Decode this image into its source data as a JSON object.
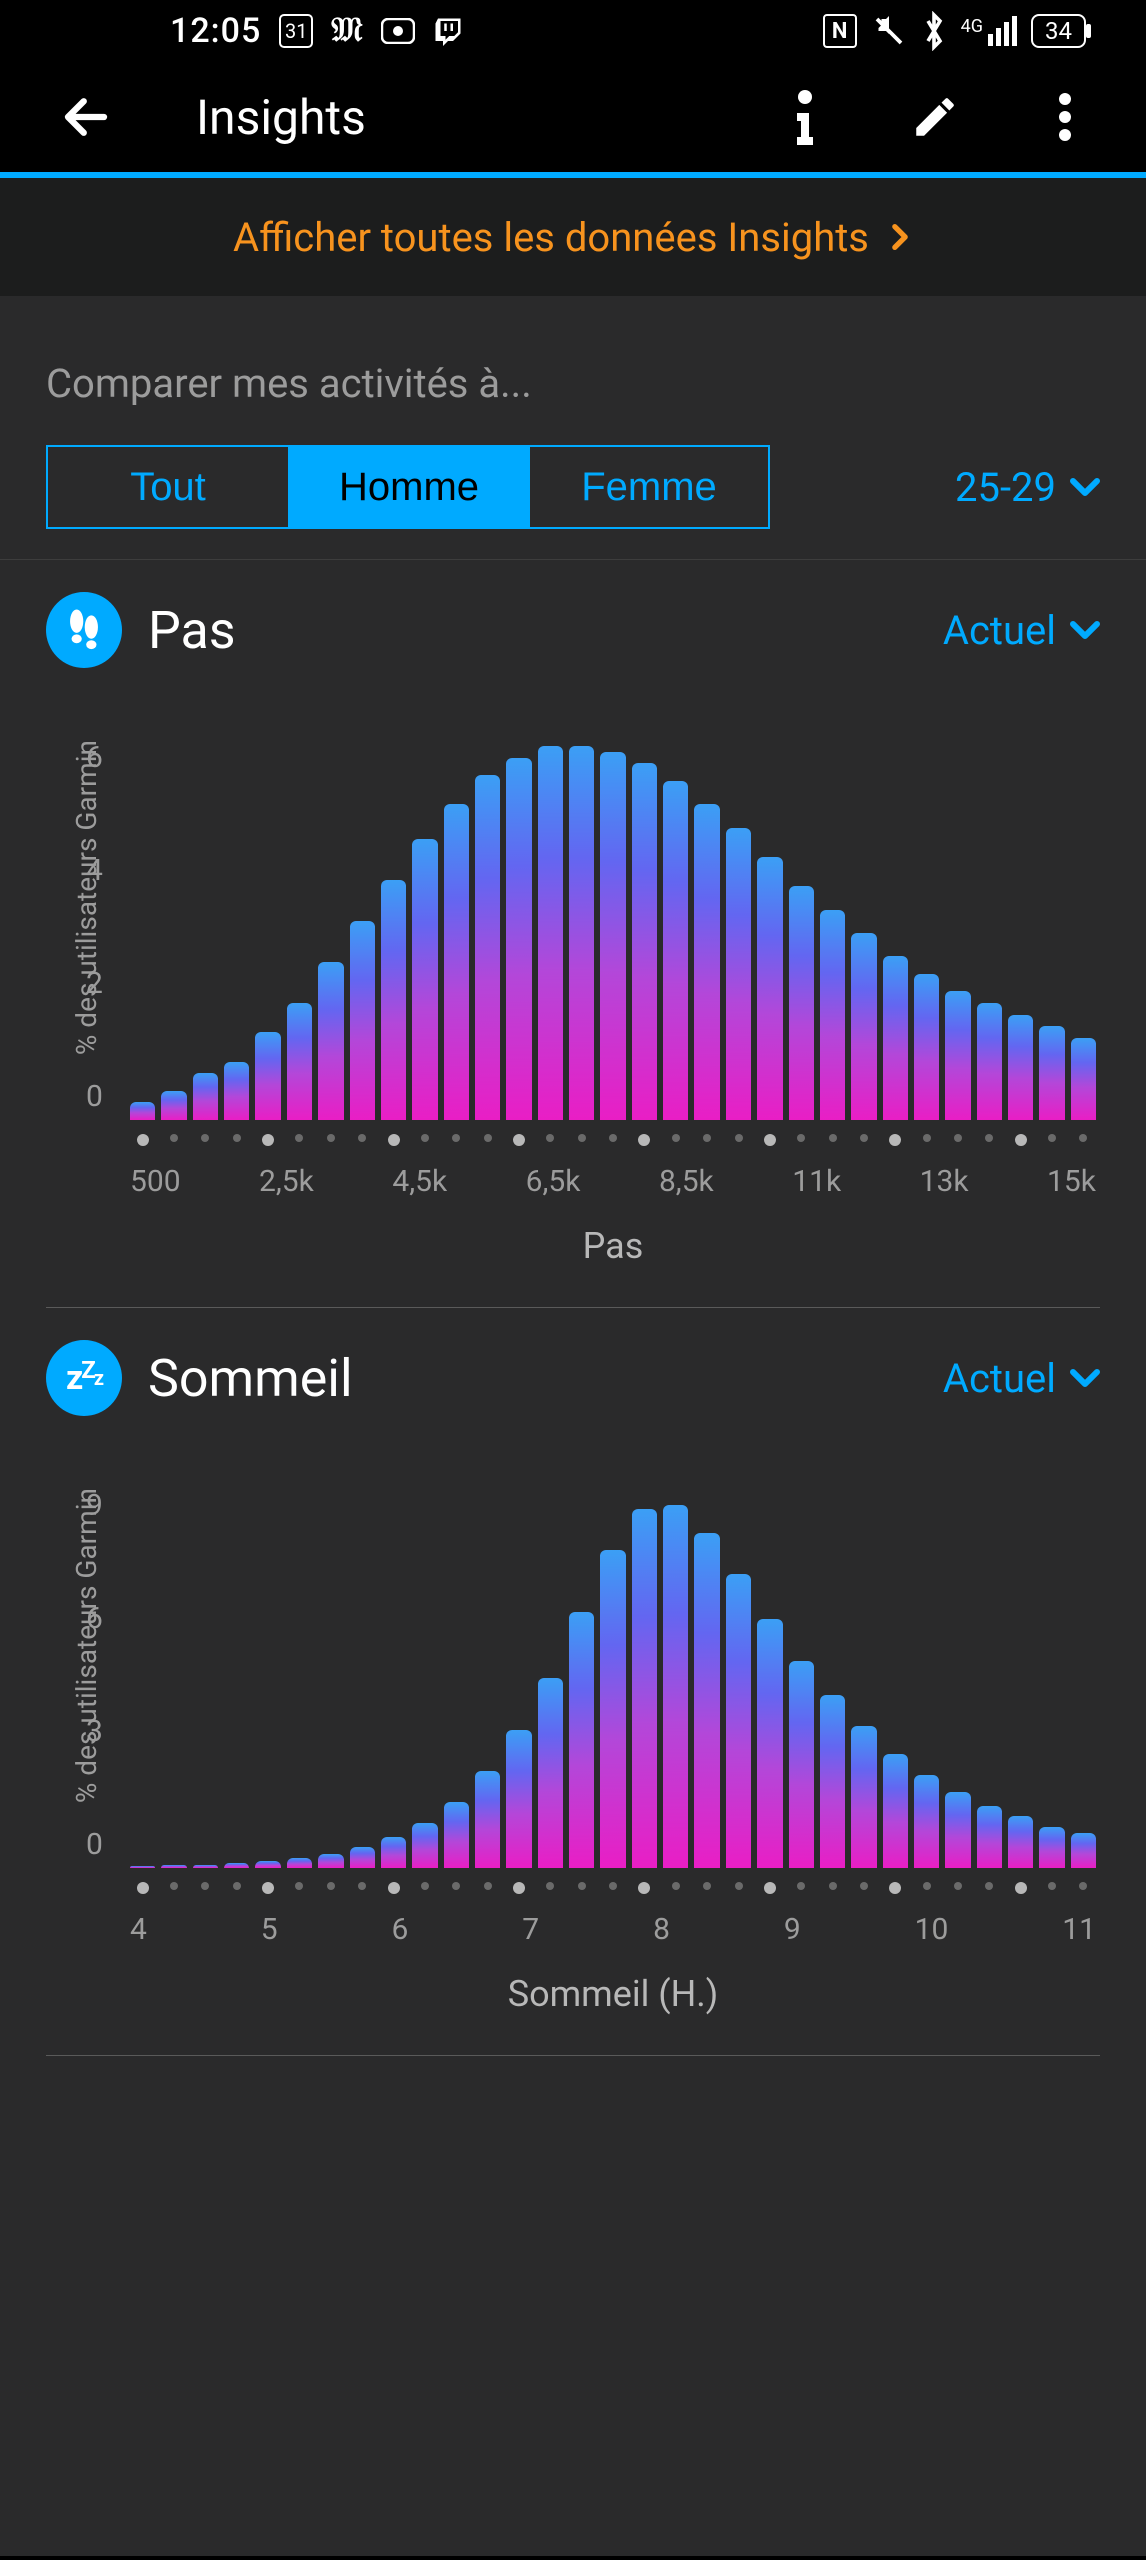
{
  "status_bar": {
    "time": "12:05",
    "calendar_day": "31",
    "icons_left": [
      "calendar",
      "newspaper",
      "camera",
      "twitch"
    ],
    "icons_right": [
      "nfc",
      "mute",
      "bluetooth",
      "signal-4g"
    ],
    "battery_pct": "34"
  },
  "header": {
    "title": "Insights"
  },
  "all_bar": {
    "label": "Afficher toutes les données Insights"
  },
  "compare": {
    "label": "Comparer mes activités à...",
    "segments": {
      "all": "Tout",
      "male": "Homme",
      "female": "Femme"
    },
    "active_segment": "male",
    "age_range": "25-29"
  },
  "cards": {
    "steps": {
      "title": "Pas",
      "period_label": "Actuel",
      "ylabel": "% des utilisateurs Garmin",
      "xlabel": "Pas",
      "y_ticks": [
        "6",
        "4",
        "2",
        "0"
      ],
      "x_ticks": [
        "500",
        "2,5k",
        "4,5k",
        "6,5k",
        "8,5k",
        "11k",
        "13k",
        "15k"
      ]
    },
    "sleep": {
      "title": "Sommeil",
      "period_label": "Actuel",
      "ylabel": "% des utilisateurs Garmin",
      "xlabel": "Sommeil (H.)",
      "y_ticks": [
        "9",
        "6",
        "3",
        "0"
      ],
      "x_ticks": [
        "4",
        "5",
        "6",
        "7",
        "8",
        "9",
        "10",
        "11"
      ]
    }
  },
  "chart_data": [
    {
      "id": "steps",
      "type": "bar",
      "title": "Pas",
      "xlabel": "Pas",
      "ylabel": "% des utilisateurs Garmin",
      "xlim": [
        500,
        15500
      ],
      "ylim": [
        0,
        6.5
      ],
      "x_step": 500,
      "categories_k": [
        "0.5",
        "1.0",
        "1.5",
        "2.0",
        "2.5",
        "3.0",
        "3.5",
        "4.0",
        "4.5",
        "5.0",
        "5.5",
        "6.0",
        "6.5",
        "7.0",
        "7.5",
        "8.0",
        "8.5",
        "9.0",
        "9.5",
        "10.0",
        "10.5",
        "11.0",
        "11.5",
        "12.0",
        "12.5",
        "13.0",
        "13.5",
        "14.0",
        "14.5",
        "15.0",
        "15.5"
      ],
      "values": [
        0.3,
        0.5,
        0.8,
        1.0,
        1.5,
        2.0,
        2.7,
        3.4,
        4.1,
        4.8,
        5.4,
        5.9,
        6.2,
        6.4,
        6.4,
        6.3,
        6.1,
        5.8,
        5.4,
        5.0,
        4.5,
        4.0,
        3.6,
        3.2,
        2.8,
        2.5,
        2.2,
        2.0,
        1.8,
        1.6,
        1.4
      ]
    },
    {
      "id": "sleep",
      "type": "bar",
      "title": "Sommeil",
      "xlabel": "Sommeil (H.)",
      "ylabel": "% des utilisateurs Garmin",
      "xlim": [
        4,
        11.5
      ],
      "ylim": [
        0,
        11
      ],
      "x_step": 0.25,
      "categories_h": [
        "4.00",
        "4.25",
        "4.50",
        "4.75",
        "5.00",
        "5.25",
        "5.50",
        "5.75",
        "6.00",
        "6.25",
        "6.50",
        "6.75",
        "7.00",
        "7.25",
        "7.50",
        "7.75",
        "8.00",
        "8.25",
        "8.50",
        "8.75",
        "9.00",
        "9.25",
        "9.50",
        "9.75",
        "10.00",
        "10.25",
        "10.50",
        "10.75",
        "11.00",
        "11.25",
        "11.50"
      ],
      "values": [
        0.05,
        0.1,
        0.1,
        0.15,
        0.2,
        0.3,
        0.4,
        0.6,
        0.9,
        1.3,
        1.9,
        2.8,
        4.0,
        5.5,
        7.4,
        9.2,
        10.4,
        10.5,
        9.7,
        8.5,
        7.2,
        6.0,
        5.0,
        4.1,
        3.3,
        2.7,
        2.2,
        1.8,
        1.5,
        1.2,
        1.0
      ]
    }
  ]
}
